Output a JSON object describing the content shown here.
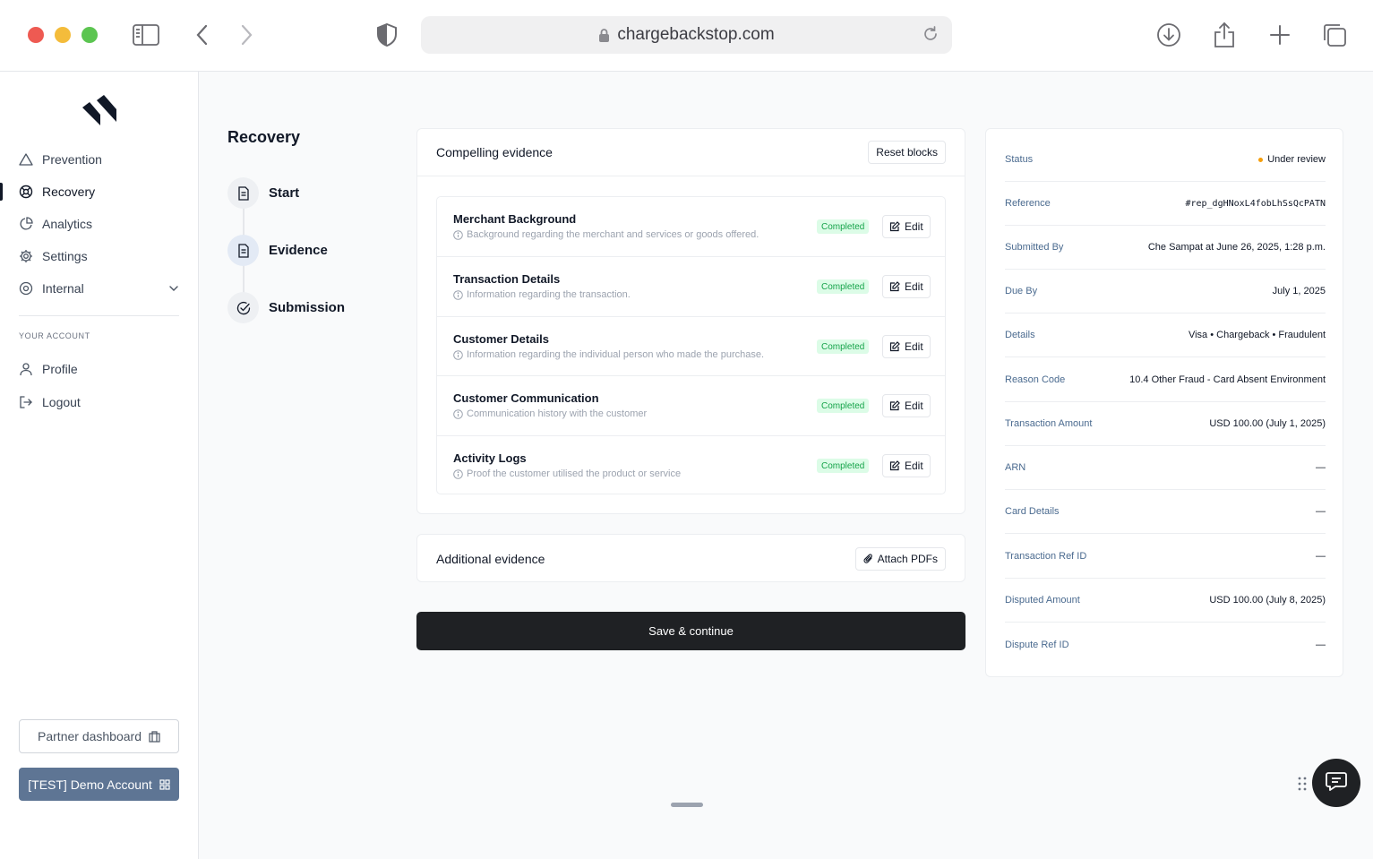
{
  "browser": {
    "url": "chargebackstop.com"
  },
  "sidebar": {
    "items": [
      {
        "label": "Prevention",
        "icon": "triangle-warning-icon"
      },
      {
        "label": "Recovery",
        "icon": "recovery-icon"
      },
      {
        "label": "Analytics",
        "icon": "pie-chart-icon"
      },
      {
        "label": "Settings",
        "icon": "gear-icon"
      },
      {
        "label": "Internal",
        "icon": "target-icon"
      }
    ],
    "section_label": "YOUR ACCOUNT",
    "account_items": [
      {
        "label": "Profile",
        "icon": "user-icon"
      },
      {
        "label": "Logout",
        "icon": "logout-icon"
      }
    ],
    "partner_button": "Partner dashboard",
    "demo_button": "[TEST] Demo Account"
  },
  "steps": {
    "title": "Recovery",
    "items": [
      {
        "label": "Start"
      },
      {
        "label": "Evidence"
      },
      {
        "label": "Submission"
      }
    ]
  },
  "compelling": {
    "title": "Compelling evidence",
    "reset_label": "Reset blocks",
    "rows": [
      {
        "title": "Merchant Background",
        "desc": "Background regarding the merchant and services or goods offered.",
        "status": "Completed",
        "edit": "Edit"
      },
      {
        "title": "Transaction Details",
        "desc": "Information regarding the transaction.",
        "status": "Completed",
        "edit": "Edit"
      },
      {
        "title": "Customer Details",
        "desc": "Information regarding the individual person who made the purchase.",
        "status": "Completed",
        "edit": "Edit"
      },
      {
        "title": "Customer Communication",
        "desc": "Communication history with the customer",
        "status": "Completed",
        "edit": "Edit"
      },
      {
        "title": "Activity Logs",
        "desc": "Proof the customer utilised the product or service",
        "status": "Completed",
        "edit": "Edit"
      }
    ]
  },
  "additional": {
    "title": "Additional evidence",
    "attach_label": "Attach PDFs"
  },
  "save_label": "Save & continue",
  "details": {
    "rows": [
      {
        "key": "Status",
        "value": "Under review"
      },
      {
        "key": "Reference",
        "value": "#rep_dgHNoxL4fobLhSsQcPATN"
      },
      {
        "key": "Submitted By",
        "value": "Che Sampat at June 26, 2025, 1:28 p.m."
      },
      {
        "key": "Due By",
        "value": "July 1, 2025"
      },
      {
        "key": "Details",
        "value": "Visa • Chargeback • Fraudulent"
      },
      {
        "key": "Reason Code",
        "value": "10.4 Other Fraud - Card Absent Environment"
      },
      {
        "key": "Transaction Amount",
        "value": "USD 100.00 (July 1, 2025)"
      },
      {
        "key": "ARN",
        "value": "—"
      },
      {
        "key": "Card Details",
        "value": "—"
      },
      {
        "key": "Transaction Ref ID",
        "value": "—"
      },
      {
        "key": "Disputed Amount",
        "value": "USD 100.00 (July 8, 2025)"
      },
      {
        "key": "Dispute Ref ID",
        "value": "—"
      }
    ]
  },
  "colors": {
    "primary_button": "#1f2124",
    "demo_button": "#5e7594",
    "completed_badge_bg": "#dcfce7",
    "completed_badge_text": "#16a34a",
    "status_dot": "#f59e0b",
    "detail_key": "#4a6a8f"
  }
}
